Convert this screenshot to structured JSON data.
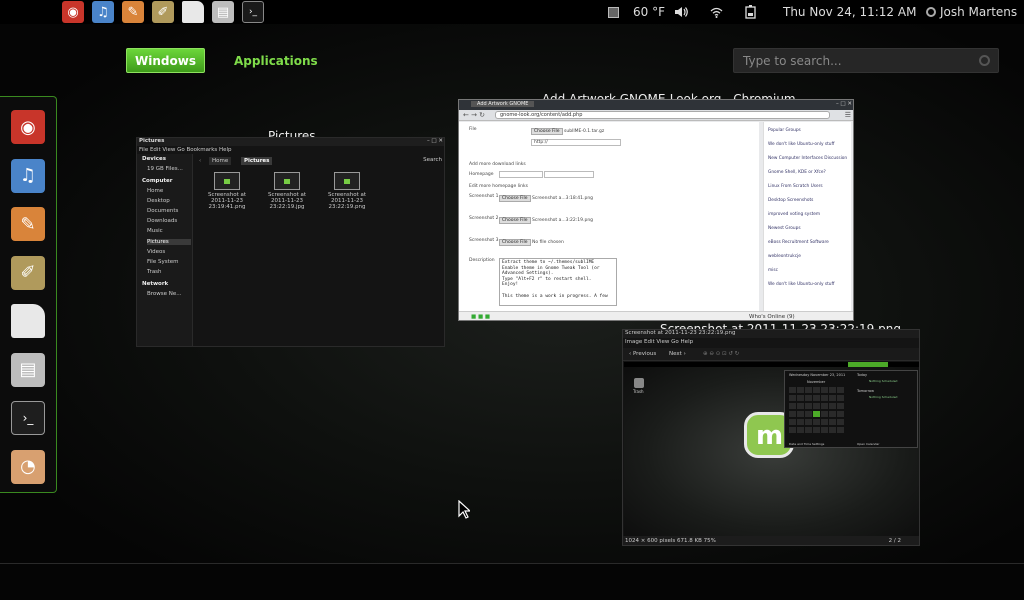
{
  "topbar": {
    "launchers": [
      {
        "name": "chromium-icon",
        "color": "#c8352a",
        "glyph": "◉"
      },
      {
        "name": "itunes-icon",
        "color": "#4a84c9",
        "glyph": "♫"
      },
      {
        "name": "paint-icon",
        "color": "#d9843a",
        "glyph": "✎"
      },
      {
        "name": "text-editor-icon",
        "color": "#b09a5c",
        "glyph": "✐"
      },
      {
        "name": "document-icon",
        "color": "#e8e8e8",
        "glyph": ""
      },
      {
        "name": "file-cabinet-icon",
        "color": "#bdbdbd",
        "glyph": "▤"
      },
      {
        "name": "terminal-icon",
        "color": "#1a1a1a",
        "glyph": "›_"
      }
    ],
    "weather": "60 °F",
    "clock": "Thu Nov 24, 11:12 AM",
    "user": "Josh Martens"
  },
  "overview": {
    "windows_tab": "Windows",
    "applications_tab": "Applications",
    "search_placeholder": "Type to search..."
  },
  "dash": [
    {
      "name": "dash-chromium",
      "color": "#c8352a",
      "glyph": "◉"
    },
    {
      "name": "dash-itunes",
      "color": "#4a84c9",
      "glyph": "♫"
    },
    {
      "name": "dash-paint",
      "color": "#d9843a",
      "glyph": "✎"
    },
    {
      "name": "dash-text-editor",
      "color": "#b09a5c",
      "glyph": "✐"
    },
    {
      "name": "dash-document",
      "color": "#e8e8e8",
      "glyph": ""
    },
    {
      "name": "dash-file-cabinet",
      "color": "#bdbdbd",
      "glyph": "▤"
    },
    {
      "name": "dash-terminal",
      "color": "#1e1e1e",
      "glyph": "›_"
    },
    {
      "name": "dash-eye-app",
      "color": "#d8a070",
      "glyph": "◔"
    }
  ],
  "windows": {
    "files": {
      "label": "Pictures",
      "titlebar": "Pictures",
      "menu": "File  Edit  View  Go  Bookmarks  Help",
      "path_home": "Home",
      "path_current": "Pictures",
      "search": "Search",
      "devices_header": "Devices",
      "device": "19 GB Files...",
      "computer_header": "Computer",
      "places": [
        "Home",
        "Desktop",
        "Documents",
        "Downloads",
        "Music",
        "Pictures",
        "Videos",
        "File System",
        "Trash"
      ],
      "network_header": "Network",
      "network_item": "Browse Ne...",
      "files": [
        "Screenshot at 2011-11-23 23:19:41.png",
        "Screenshot at 2011-11-23 23:22:19.jpg",
        "Screenshot at 2011-11-23 23:22:19.png"
      ]
    },
    "chrome": {
      "label": "Add  Artwork GNOME-Look.org - Chromium",
      "tab": "Add  Artwork GNOME",
      "url": "gnome-look.org/content/add.php",
      "rows": [
        "File",
        "Add more download links",
        "Homepage",
        "Edit more homepage links",
        "Screenshot 1",
        "Screenshot 2",
        "Screenshot 3",
        "Description"
      ],
      "shots": [
        "Screenshot a...3:18:41.png",
        "Screenshot a...3:22:19.png",
        "No file chosen"
      ],
      "choose": "Choose File",
      "file_value": "sublIME-0.1.tar.gz",
      "link_value": "http://",
      "desc": [
        "Extract theme to ~/.themes/sublIME",
        "Enable theme in Gnome Tweak Tool (or",
        "Advanced Settings).",
        "Type \"Alt+F2 r\" to restart shell.",
        "Enjoy!",
        "",
        "This theme is a work in progress. A few"
      ],
      "sidebar": [
        "Popular Groups",
        "We don't like Ubuntu-only stuff",
        "New Computer Interfaces Discussion",
        "Gnome Shell, KDE or Xfce?",
        "Linux From Scratch Users",
        "Desktop Screenshots",
        "improved voting system",
        "Newest Groups",
        "eBoss Recruitment Software",
        "webleontrukcje",
        "misc",
        "We don't like Ubuntu-only stuff"
      ],
      "footer": "Who's Online (9)"
    },
    "image": {
      "label": "Screenshot at 2011-11-23 23:22:19.png",
      "previous": "Previous",
      "next": "Next",
      "status_size": "1024 × 600 pixels   671.8 KB   75%",
      "page": "2 / 2",
      "trash": "Trash",
      "cal_title": "Wednesday November 23, 2011",
      "cal_month": "November",
      "today": "Today",
      "tomorrow": "Tomorrow",
      "nothing": "Nothing Scheduled",
      "date_time_settings": "Date and Time Settings",
      "open_calendar": "Open Calendar"
    }
  }
}
